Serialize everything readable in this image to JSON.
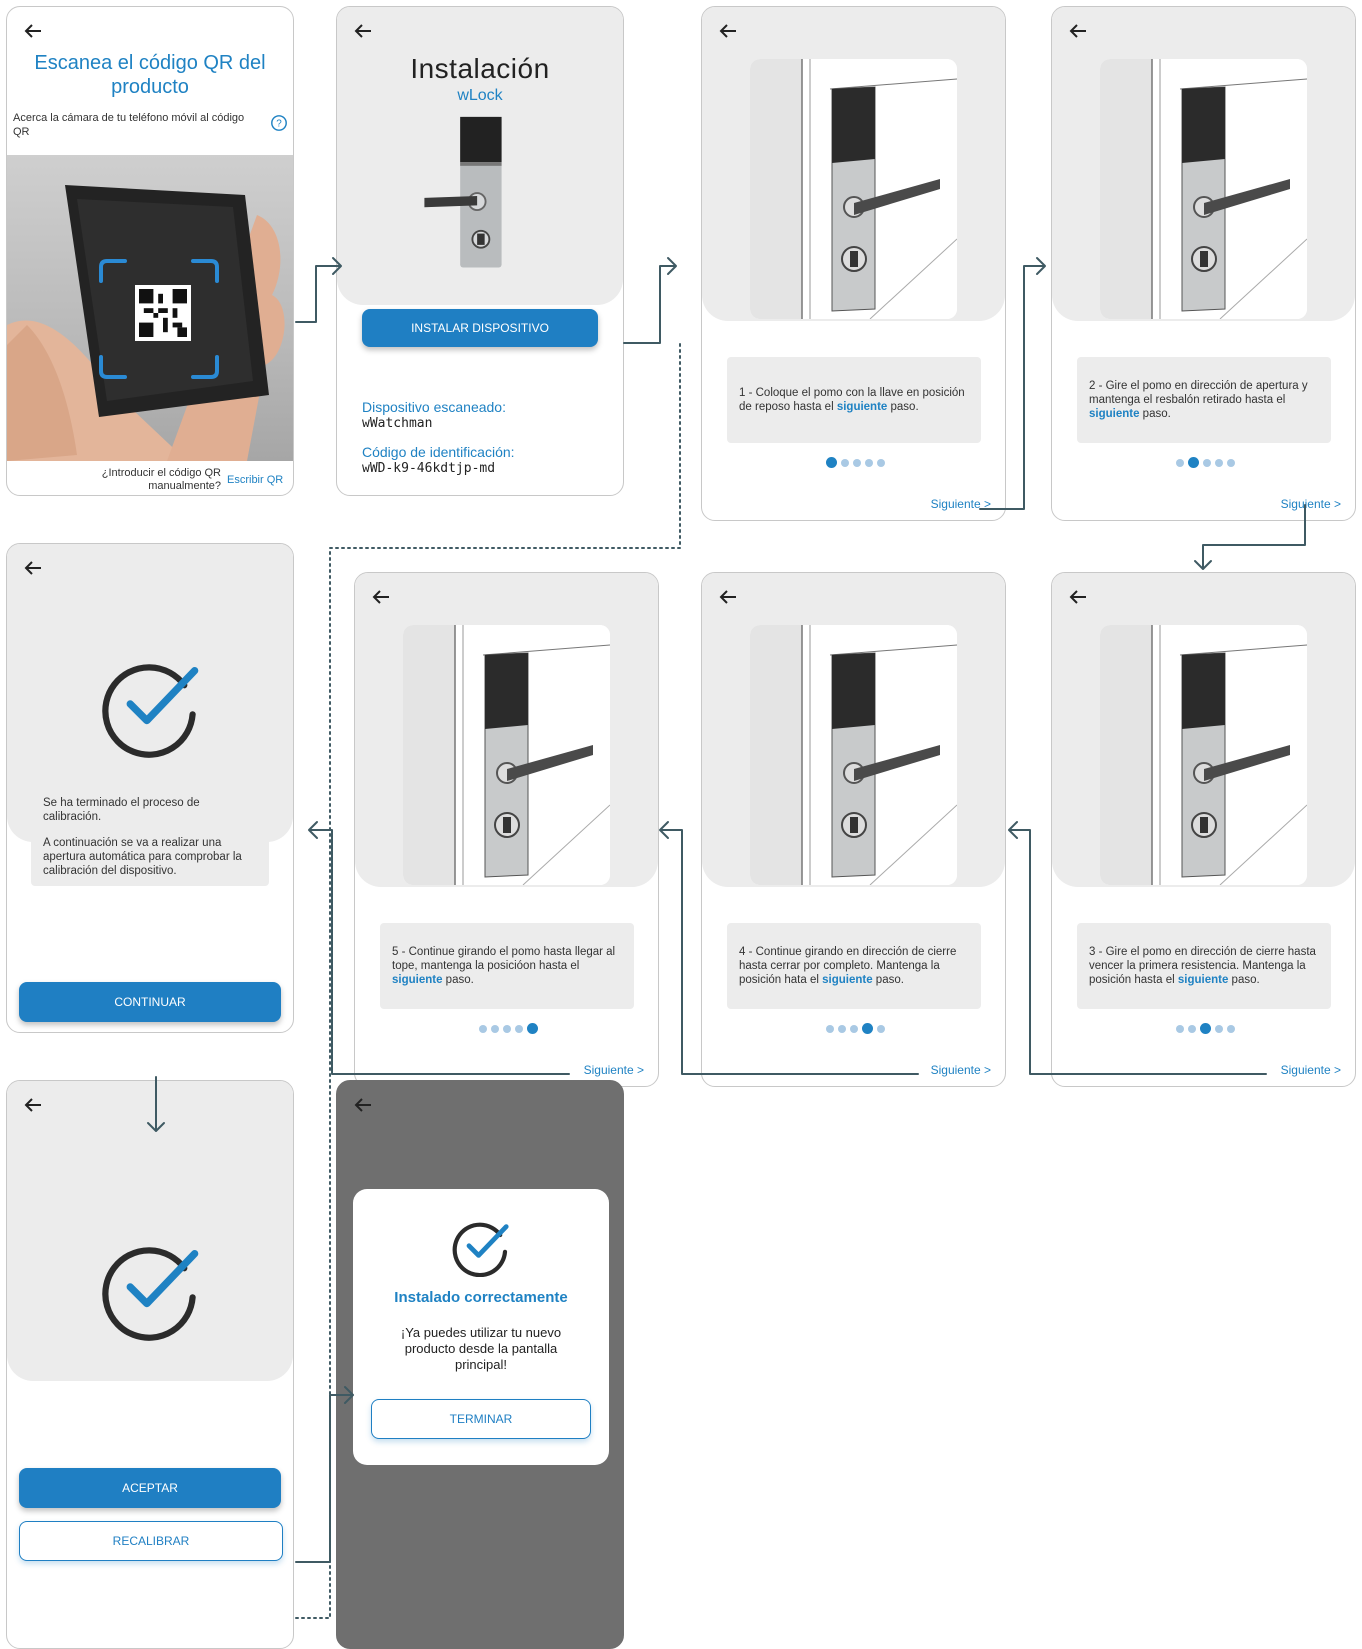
{
  "screen_qr": {
    "title": "Escanea el código QR del producto",
    "subtitle": "Acerca la cámara de tu teléfono móvil al código QR",
    "manual_prompt": "¿Introducir el código QR manualmente?",
    "manual_link": "Escribir QR"
  },
  "screen_install": {
    "title": "Instalación",
    "product": "wLock",
    "install_button": "INSTALAR DISPOSITIVO",
    "scanned_label": "Dispositivo escaneado:",
    "scanned_value": "wWatchman",
    "id_label": "Código de identificación:",
    "id_value": "wWD-k9-46kdtjp-md"
  },
  "steps": [
    {
      "prefix": "1 - Coloque el pomo con la llave en posición de reposo hasta el ",
      "link": "siguiente",
      "suffix": " paso.",
      "active_dot": 0
    },
    {
      "prefix": "2 - Gire el pomo en dirección de apertura y mantenga el resbalón retirado hasta el ",
      "link": "siguiente",
      "suffix": " paso.",
      "active_dot": 1
    },
    {
      "prefix": "3 - Gire el pomo en dirección de cierre hasta vencer la primera resistencia. Mantenga la posición hasta el ",
      "link": "siguiente",
      "suffix": " paso.",
      "active_dot": 2
    },
    {
      "prefix": "4 - Continue girando en dirección de cierre hasta cerrar por completo. Mantenga la posición hata el ",
      "link": "siguiente",
      "suffix": " paso.",
      "active_dot": 3
    },
    {
      "prefix": "5 - Continue girando el pomo hasta llegar al tope, mantenga la posicióon hasta el ",
      "link": "siguiente",
      "suffix": " paso.",
      "active_dot": 4
    }
  ],
  "next_label": "Siguiente >",
  "screen_calibrated": {
    "line1": "Se ha terminado el proceso de calibración.",
    "line2": "A continuación se va a realizar una apertura automática para comprobar la calibración del dispositivo.",
    "continue_button": "CONTINUAR"
  },
  "screen_check": {
    "accept_button": "ACEPTAR",
    "recalibrate_button": "RECALIBRAR"
  },
  "screen_done": {
    "title": "Instalado correctamente",
    "message": "¡Ya puedes utilizar tu nuevo producto desde la pantalla principal!",
    "finish_button": "TERMINAR"
  },
  "colors": {
    "accent": "#1f7fc3",
    "gray_panel": "#ececec",
    "overlay": "#6f6f6f",
    "flow_line": "#3f5a63"
  }
}
